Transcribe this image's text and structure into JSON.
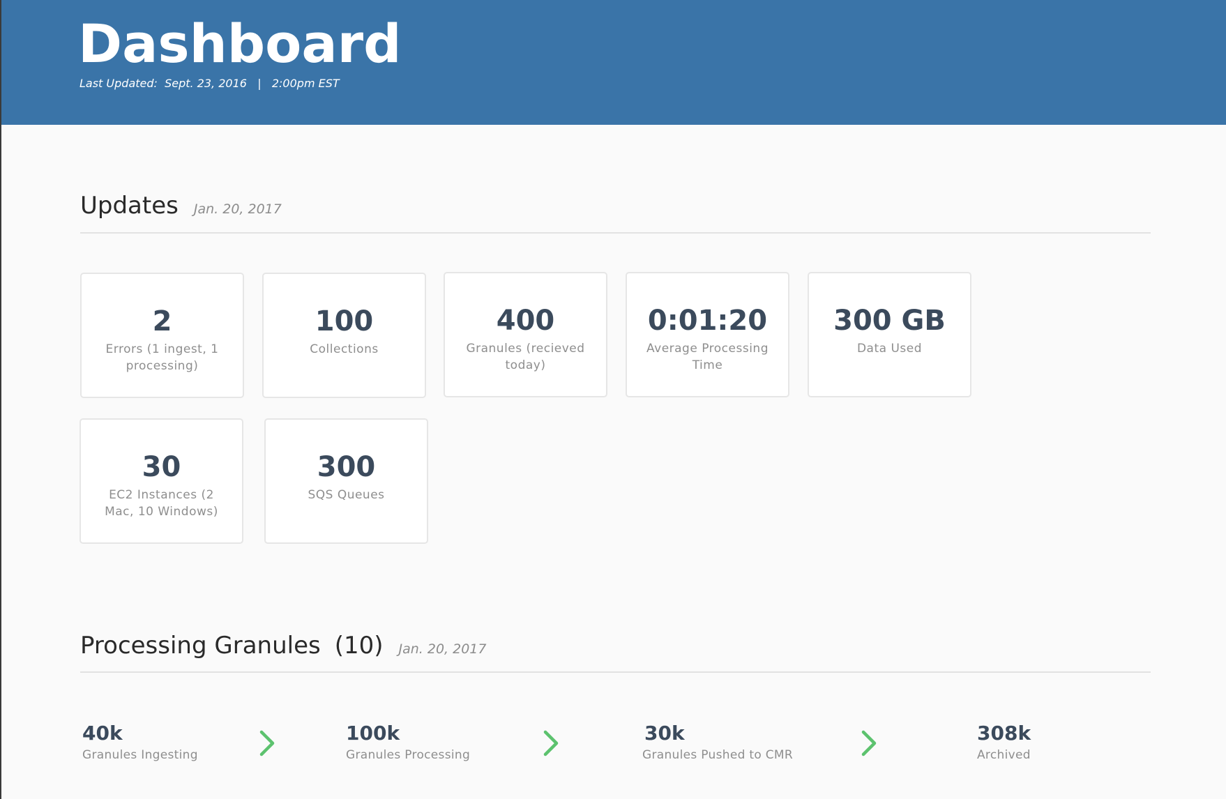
{
  "header": {
    "title": "Dashboard",
    "last_updated_label": "Last Updated:",
    "last_updated_date": "Sept. 23, 2016",
    "separator": "|",
    "last_updated_time": "2:00pm EST",
    "background_color": "#3a74a8"
  },
  "updates": {
    "title": "Updates",
    "date": "Jan. 20, 2017",
    "cards": [
      {
        "value": "2",
        "label": "Errors (1 ingest, 1 processing)"
      },
      {
        "value": "100",
        "label": "Collections"
      },
      {
        "value": "400",
        "label": "Granules (recieved today)"
      },
      {
        "value": "0:01:20",
        "label": "Average Processing Time"
      },
      {
        "value": "300 GB",
        "label": "Data Used"
      },
      {
        "value": "30",
        "label": "EC2 Instances (2 Mac, 10 Windows)"
      },
      {
        "value": "300",
        "label": "SQS Queues"
      }
    ]
  },
  "processing": {
    "title": "Processing Granules",
    "count": "(10)",
    "date": "Jan. 20, 2017",
    "stages": [
      {
        "value": "40k",
        "label": "Granules Ingesting"
      },
      {
        "value": "100k",
        "label": "Granules Processing"
      },
      {
        "value": "30k",
        "label": "Granules Pushed to CMR"
      },
      {
        "value": "308k",
        "label": "Archived"
      }
    ],
    "arrow_icon": "chevron-right-icon",
    "arrow_color": "#5cc26e"
  }
}
